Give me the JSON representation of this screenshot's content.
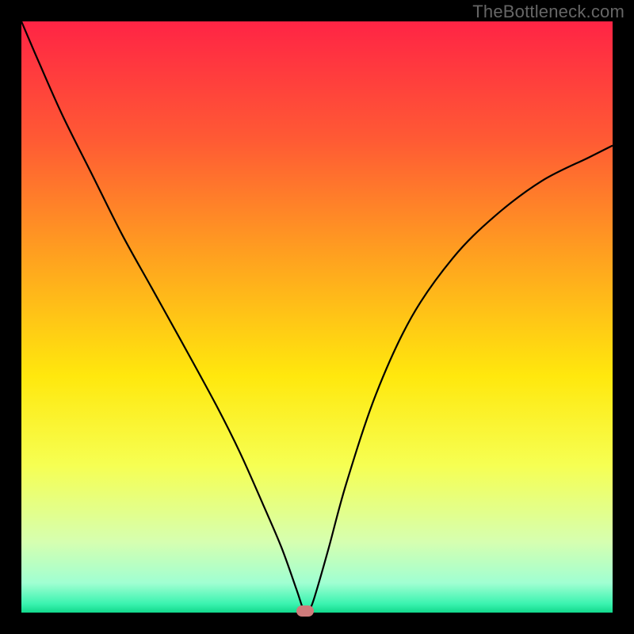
{
  "watermark": "TheBottleneck.com",
  "chart_data": {
    "type": "line",
    "title": "",
    "xlabel": "",
    "ylabel": "",
    "xlim": [
      0,
      100
    ],
    "ylim": [
      0,
      100
    ],
    "grid": false,
    "legend": false,
    "background_gradient": {
      "stops": [
        {
          "offset": 0.0,
          "color": "#ff2445"
        },
        {
          "offset": 0.2,
          "color": "#ff5a34"
        },
        {
          "offset": 0.4,
          "color": "#ffa21f"
        },
        {
          "offset": 0.6,
          "color": "#ffe80d"
        },
        {
          "offset": 0.75,
          "color": "#f6ff52"
        },
        {
          "offset": 0.88,
          "color": "#d6ffb0"
        },
        {
          "offset": 0.95,
          "color": "#a0ffd2"
        },
        {
          "offset": 0.985,
          "color": "#3bf3b0"
        },
        {
          "offset": 1.0,
          "color": "#12d98c"
        }
      ]
    },
    "series": [
      {
        "name": "bottleneck-curve",
        "color": "#000000",
        "x": [
          0,
          3,
          7,
          12,
          17,
          22,
          27,
          33,
          37,
          41,
          44,
          46.5,
          47.5,
          48,
          49,
          50,
          52,
          55,
          60,
          66,
          73,
          80,
          88,
          96,
          100
        ],
        "y": [
          100,
          93,
          84,
          74,
          64,
          55,
          46,
          35,
          27,
          18,
          11,
          4,
          1,
          0,
          1,
          4,
          11,
          22,
          37,
          50,
          60,
          67,
          73,
          77,
          79
        ]
      }
    ],
    "marker": {
      "x": 48,
      "y": 0,
      "color": "#cf7b7b"
    }
  }
}
